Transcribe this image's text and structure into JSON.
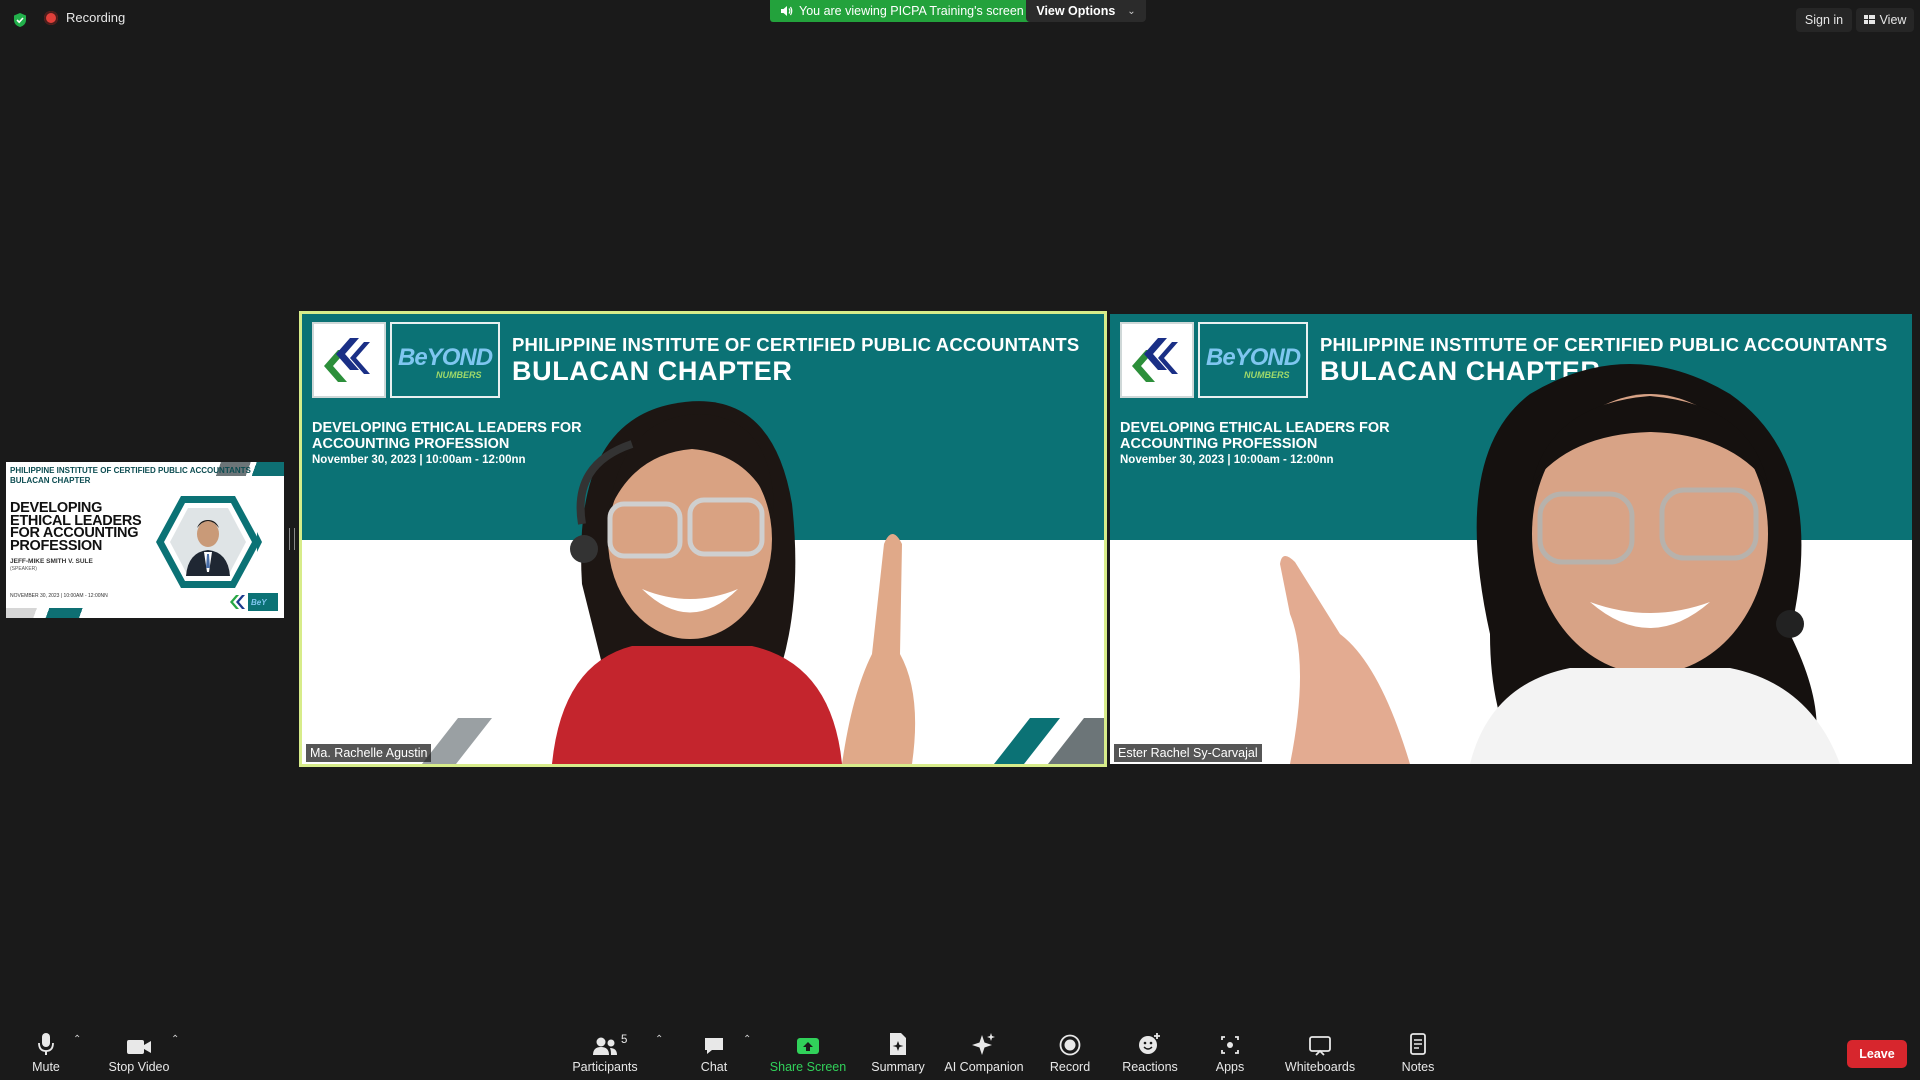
{
  "top": {
    "recording_label": "Recording",
    "viewing_banner": "You are viewing PICPA Training's screen",
    "view_options": "View Options",
    "sign_in": "Sign in",
    "view": "View"
  },
  "thumbnail": {
    "org_line1": "PHILIPPINE INSTITUTE OF CERTIFIED PUBLIC ACCOUNTANTS",
    "org_line2": "BULACAN CHAPTER",
    "title_lines": [
      "DEVELOPING",
      "ETHICAL LEADERS",
      "FOR ACCOUNTING",
      "PROFESSION"
    ],
    "speaker": "JEFF-MIKE SMITH V. SULE",
    "role": "(SPEAKER)",
    "date": "NOVEMBER 30, 2023 | 10:00AM - 12:00NN"
  },
  "tiles": [
    {
      "org": "PHILIPPINE INSTITUTE OF CERTIFIED PUBLIC ACCOUNTANTS",
      "chapter": "BULACAN CHAPTER",
      "title1": "DEVELOPING ETHICAL LEADERS FOR",
      "title2": "ACCOUNTING PROFESSION",
      "date": "November 30, 2023 | 10:00am - 12:00nn",
      "beyond": "BeYOND",
      "numbers": "NUMBERS",
      "name": "Ma. Rachelle Agustin"
    },
    {
      "org": "PHILIPPINE INSTITUTE OF CERTIFIED PUBLIC ACCOUNTANTS",
      "chapter": "BULACAN CHAPTER",
      "title1": "DEVELOPING ETHICAL LEADERS FOR",
      "title2": "ACCOUNTING PROFESSION",
      "date": "November 30, 2023 | 10:00am - 12:00nn",
      "beyond": "BeYOND",
      "numbers": "NUMBERS",
      "name": "Ester Rachel Sy-Carvajal"
    }
  ],
  "toolbar": {
    "mute": "Mute",
    "stop_video": "Stop Video",
    "participants": "Participants",
    "participants_count": "5",
    "chat": "Chat",
    "share_screen": "Share Screen",
    "summary": "Summary",
    "ai_companion": "AI Companion",
    "record": "Record",
    "reactions": "Reactions",
    "apps": "Apps",
    "whiteboards": "Whiteboards",
    "notes": "Notes",
    "leave": "Leave"
  },
  "colors": {
    "banner_green": "#23a23c",
    "slide_teal": "#0b7275",
    "active_speaker_border": "#d7ec8a",
    "leave_red": "#d7262d"
  }
}
